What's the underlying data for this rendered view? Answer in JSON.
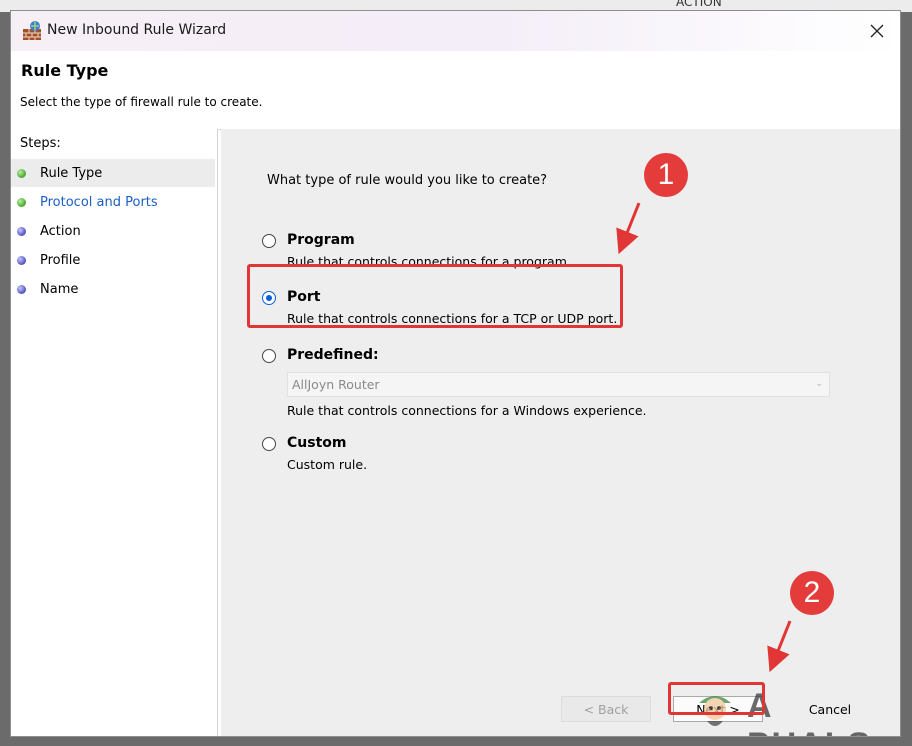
{
  "background": {
    "partial_text": "ACTION"
  },
  "window": {
    "title": "New Inbound Rule Wizard",
    "icon": "firewall-wall-icon",
    "close_icon": "close-icon"
  },
  "header": {
    "title": "Rule Type",
    "subtitle": "Select the type of firewall rule to create."
  },
  "sidebar": {
    "steps_label": "Steps:",
    "items": [
      {
        "label": "Rule Type",
        "state": "done",
        "current": true
      },
      {
        "label": "Protocol and Ports",
        "state": "done",
        "link": true
      },
      {
        "label": "Action",
        "state": "todo"
      },
      {
        "label": "Profile",
        "state": "todo"
      },
      {
        "label": "Name",
        "state": "todo"
      }
    ]
  },
  "main": {
    "question": "What type of rule would you like to create?",
    "options": [
      {
        "label": "Program",
        "description": "Rule that controls connections for a program.",
        "checked": false
      },
      {
        "label": "Port",
        "description": "Rule that controls connections for a TCP or UDP port.",
        "checked": true
      },
      {
        "label": "Predefined:",
        "description": "Rule that controls connections for a Windows experience.",
        "checked": false
      },
      {
        "label": "Custom",
        "description": "Custom rule.",
        "checked": false
      }
    ],
    "predefined_select": {
      "value": "AllJoyn Router",
      "enabled": false
    }
  },
  "buttons": {
    "back": "< Back",
    "next": "Next >",
    "cancel": "Cancel"
  },
  "annotations": {
    "badge_1": "1",
    "badge_2": "2",
    "color": "#e23636"
  },
  "watermark": {
    "text": "A PUALS"
  },
  "colors": {
    "accent": "#0b5fd7",
    "link": "#1a5fc2",
    "step_done": "#46a528",
    "step_todo": "#4f4fc0"
  }
}
